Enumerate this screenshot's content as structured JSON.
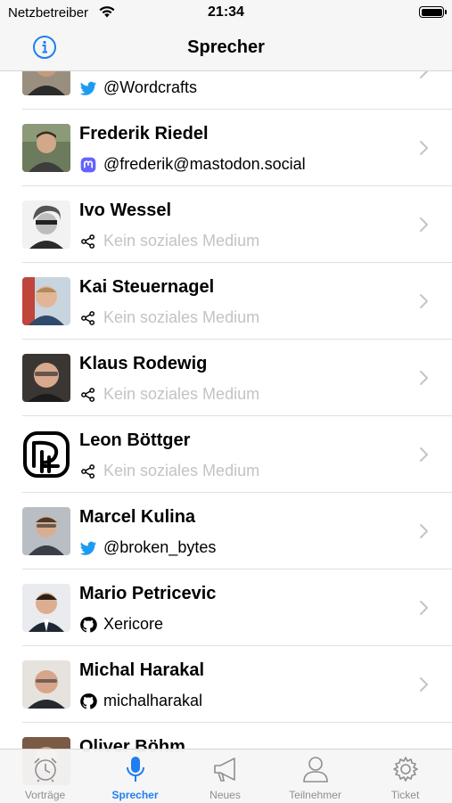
{
  "status_bar": {
    "carrier": "Netzbetreiber",
    "time": "21:34"
  },
  "nav": {
    "title": "Sprecher",
    "info_icon": "info-icon"
  },
  "speakers": [
    {
      "name": "",
      "social_type": "twitter",
      "social": "@Wordcrafts"
    },
    {
      "name": "Frederik Riedel",
      "social_type": "mastodon",
      "social": "@frederik@mastodon.social"
    },
    {
      "name": "Ivo Wessel",
      "social_type": "none",
      "social": "Kein soziales Medium"
    },
    {
      "name": "Kai Steuernagel",
      "social_type": "none",
      "social": "Kein soziales Medium"
    },
    {
      "name": "Klaus Rodewig",
      "social_type": "none",
      "social": "Kein soziales Medium"
    },
    {
      "name": "Leon Böttger",
      "social_type": "none",
      "social": "Kein soziales Medium"
    },
    {
      "name": "Marcel Kulina",
      "social_type": "twitter",
      "social": "@broken_bytes"
    },
    {
      "name": "Mario Petricevic",
      "social_type": "github",
      "social": "Xericore"
    },
    {
      "name": "Michal Harakal",
      "social_type": "github",
      "social": "michalharakal"
    },
    {
      "name": "Oliver Böhm",
      "social_type": "",
      "social": ""
    }
  ],
  "tabs": [
    {
      "label": "Vorträge",
      "icon": "alarm-clock-icon",
      "active": false
    },
    {
      "label": "Sprecher",
      "icon": "microphone-icon",
      "active": true
    },
    {
      "label": "Neues",
      "icon": "megaphone-icon",
      "active": false
    },
    {
      "label": "Teilnehmer",
      "icon": "person-icon",
      "active": false
    },
    {
      "label": "Ticket",
      "icon": "gear-icon",
      "active": false
    }
  ],
  "colors": {
    "accent": "#1f7ff0",
    "inactive_tab": "#8e8e93",
    "twitter": "#1d9bf0",
    "mastodon": "#6364ff",
    "placeholder": "#c3c3c7"
  }
}
